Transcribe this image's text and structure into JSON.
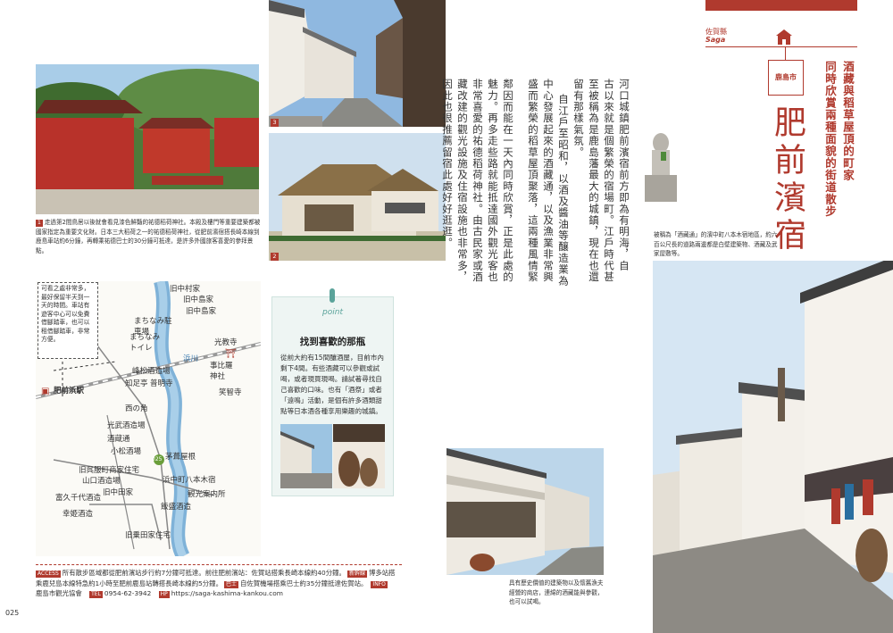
{
  "header": {
    "prefecture": "佐賀縣",
    "prefecture_roman": "Saga",
    "city_tag": "鹿島市",
    "title": "肥前濱宿",
    "subtitle_line1": "酒藏與稻草屋頂的町家",
    "subtitle_line2": "同時欣賞兩種面貌的街道散步"
  },
  "captions": {
    "photo1": "走過第2間鳥居以後就會看見漆色鮮豔的祐德稻荷神社。本殿及樓門等重要建築都被國家指定為重要文化財。日本三大稻荷之一的祐德稻荷神社，從肥前濱宿搭長崎本線到鹿島車站約6分鐘，再轉乘祐德巴士的30分鐘可抵達，是許多外國旅客喜愛的參拜景點。",
    "photo2": "茅草屋頂的建築為最古老的形式之一，是作為傳統建築保存地區中的重要建築。稻草屋頂的民家與白牆的酒藏交錯而立。",
    "right_photo": "被稱為「酒藏通」的濱中町八本木宿地區，約六百公尺長的道路兩邊都是白壁建築物、酒藏及武家屋敷等。",
    "bottom_photo": "具有歷史價值的建築物以及懷舊漁夫經營的商店，連綿的酒藏能與參觀，也可以試喝。"
  },
  "numbers": {
    "n1": "1",
    "n2": "2",
    "n3": "3"
  },
  "body_columns": [
    "河口城鎮肥前濱宿前方即為有明海，自",
    "古以來就是個繁榮的宿場町。江戶時代甚",
    "至被稱為是鹿島藩最大的城鎮，現在也還",
    "留有那樣氣氛。",
    "自江戶至昭和，以酒及醬油等釀造業為",
    "中心發展起來的酒藏通，以及漁業非常興",
    "盛而繁榮的稻草屋頂聚落，這兩種風情緊",
    "鄰因而能在一天內同時欣賞，正是此處的",
    "魅力。再多走些路就能抵達國外觀光客也",
    "非常喜愛的祐德稻荷神社。由古民家或酒",
    "藏改建的觀光設施及住宿設施也非常多，",
    "因此也很推薦留宿此處好好逛逛。"
  ],
  "map": {
    "note": "可看之處非常多，最好保留半天到一天的時間。車站有遊客中心可以免費借腳踏車，也可以租借腳踏車，非常方便。",
    "labels": [
      "旧中村家",
      "旧中島家",
      "旧中島家",
      "まちなみ駐車場",
      "まちなみトイレ",
      "光教寺",
      "峰松酒造場",
      "知足亭",
      "普明寺",
      "事比羅神社",
      "笑智寺",
      "肥前浜駅",
      "浜川",
      "西の角",
      "光武酒造場",
      "酒蔵通",
      "小松酒場",
      "旧呉服町商家住宅",
      "山口酒造場",
      "旧中田家",
      "茅葺屋根",
      "浜中町八本木宿",
      "旧乗田家住宅",
      "富久千代酒造",
      "幸姫酒造",
      "飯盛酒造",
      "観光案内所"
    ],
    "pin_number": "025"
  },
  "point": {
    "label": "point",
    "title": "找到喜歡的那瓶",
    "text": "從前大約有15間釀酒屋，目前市內剩下4間。有些酒藏可以參觀或試喝，或者現買現喝。請試著尋找自己喜歡的口味。也有「酒祭」或者「遠鳴」活動，是個有許多酒類甜點等日本酒各種享用樂趣的城鎮。"
  },
  "access": {
    "label": "ACCESS",
    "line1": "所有散步區域都從肥前濱站步行約7分鐘可抵達。前往肥前濱站：佐賀站搭乘長崎本線約40分鐘。",
    "tag1": "新幹線",
    "line1b": "博多站搭",
    "line2": "乘鹿兒島本線特急約1小時至肥前鹿島站轉搭長崎本線約5分鐘。",
    "tag2": "巴士",
    "line2b": "自佐賀機場搭乘巴士約35分鐘抵達佐賀站。",
    "tag3": "INFO",
    "org": "鹿島市觀光協會",
    "tel_label": "TEL",
    "tel": "0954-62-3942",
    "hp_label": "HP",
    "url": "https://saga-kashima-kankou.com"
  },
  "page_number": "025",
  "colors": {
    "accent": "#b03a2e",
    "teal": "#5aa39a",
    "river": "#7fb2d8"
  },
  "icons": [
    "house-icon",
    "pin-icon",
    "torii-icon",
    "train-icon"
  ]
}
